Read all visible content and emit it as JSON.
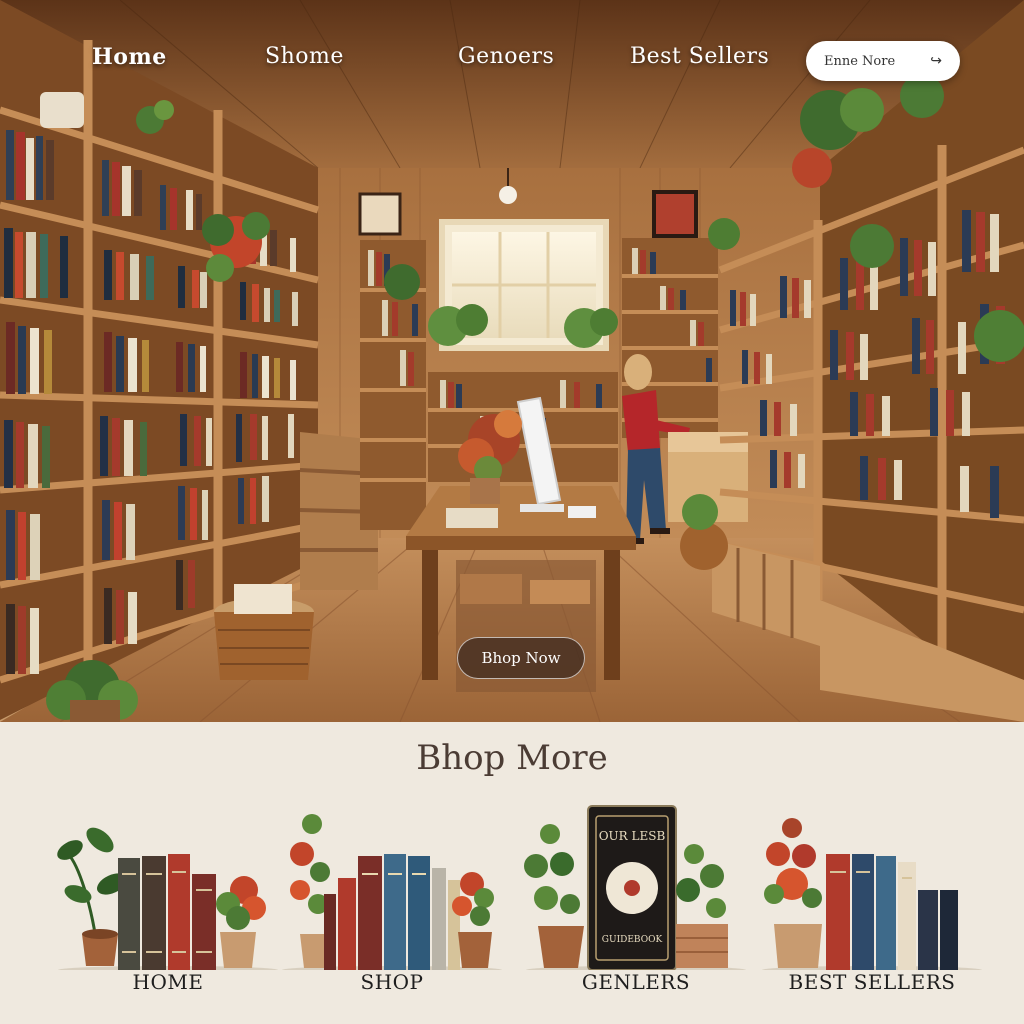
{
  "nav": {
    "home": "Home",
    "shome": "Shome",
    "genres": "Genoers",
    "best_sellers": "Best Sellers",
    "search_label": "Enne Nore",
    "search_arrow": "↪"
  },
  "hero": {
    "cta": "Bhop Now"
  },
  "section": {
    "title": "Bhop More",
    "categories": [
      "HOME",
      "SHOP",
      "GENLERS",
      "BEST SELLERS"
    ]
  },
  "cover_text": {
    "line1": "OUR LESB",
    "line2": "GUIDEBOOK"
  }
}
